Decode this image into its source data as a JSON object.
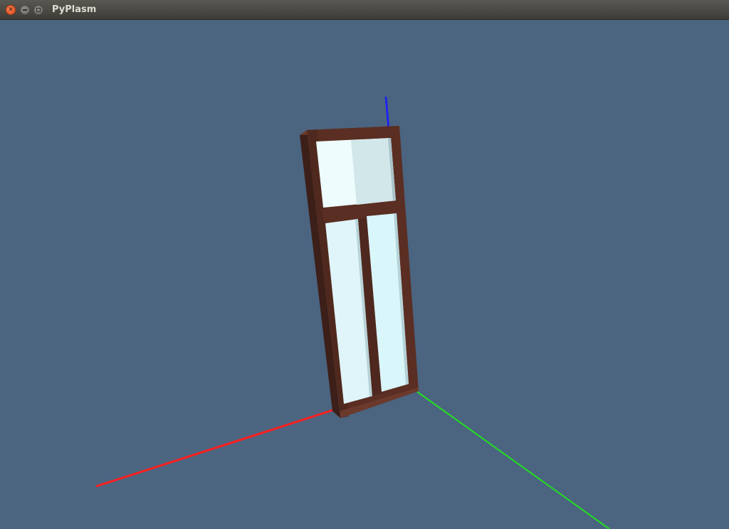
{
  "window": {
    "title": "PyPlasm",
    "buttons": {
      "close": "close-icon",
      "minimize": "minimize-icon",
      "maximize": "maximize-icon"
    }
  },
  "scene": {
    "background_color": "#4b6480",
    "axes": {
      "x_color": "#ff1f1f",
      "y_color": "#22e022",
      "z_color": "#1a1aff"
    },
    "model": "window-frame",
    "frame_color": "#5a2e22",
    "glass_color": "#dff6fb"
  }
}
